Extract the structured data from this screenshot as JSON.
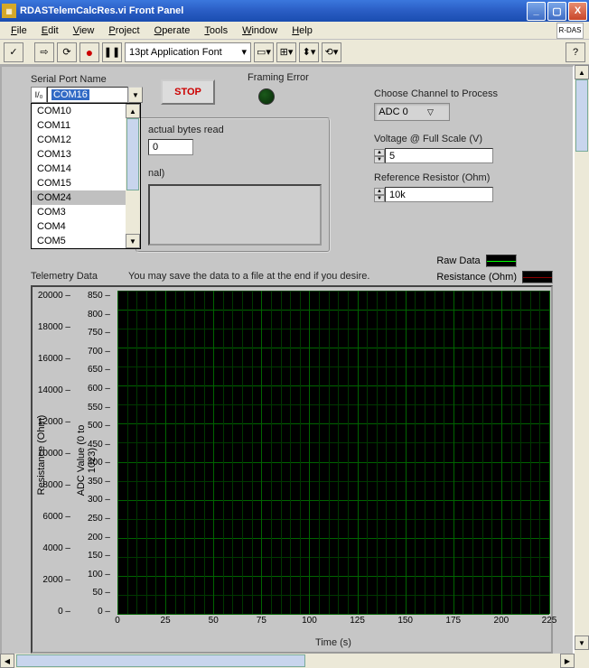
{
  "window": {
    "title": "RDASTelemCalcRes.vi Front Panel"
  },
  "menubar": {
    "file": "File",
    "edit": "Edit",
    "view": "View",
    "project": "Project",
    "operate": "Operate",
    "tools": "Tools",
    "window": "Window",
    "help": "Help",
    "rdas": "R-DAS"
  },
  "toolbar": {
    "font": "13pt Application Font"
  },
  "serial": {
    "label": "Serial Port Name",
    "value": "COM16",
    "options": [
      "COM10",
      "COM11",
      "COM12",
      "COM13",
      "COM14",
      "COM15",
      "COM24",
      "COM3",
      "COM4",
      "COM5"
    ],
    "selected_index": 6
  },
  "stop": {
    "label": "STOP"
  },
  "framing": {
    "label": "Framing Error"
  },
  "bytes": {
    "label": "actual bytes read",
    "value": "0",
    "optional_label": "nal)"
  },
  "channel": {
    "label": "Choose Channel to Process",
    "value": "ADC 0"
  },
  "voltage": {
    "label": "Voltage @ Full Scale (V)",
    "value": "5"
  },
  "resistor": {
    "label": "Reference Resistor (Ohm)",
    "value": "10k"
  },
  "legend": {
    "raw": "Raw Data",
    "res": "Resistance (Ohm)"
  },
  "telemetry_label": "Telemetry Data",
  "save_note": "You may save the data to a file at the end if you desire.",
  "chart_data": {
    "type": "line",
    "series": [
      {
        "name": "Raw Data (ADC Value)",
        "values": []
      },
      {
        "name": "Resistance (Ohm)",
        "values": []
      }
    ],
    "x": [],
    "xlabel": "Time (s)",
    "xlim": [
      0,
      225
    ],
    "xticks": [
      0,
      25,
      50,
      75,
      100,
      125,
      150,
      175,
      200,
      225
    ],
    "y_axes": [
      {
        "label": "Resistance (Ohm)",
        "lim": [
          0,
          20000
        ],
        "ticks": [
          0,
          2000,
          4000,
          6000,
          8000,
          10000,
          12000,
          14000,
          16000,
          18000,
          20000
        ]
      },
      {
        "label": "ADC Value (0 to 1023)",
        "lim": [
          0,
          850
        ],
        "ticks": [
          0,
          50,
          100,
          150,
          200,
          250,
          300,
          350,
          400,
          450,
          500,
          550,
          600,
          650,
          700,
          750,
          800,
          850
        ]
      }
    ]
  }
}
